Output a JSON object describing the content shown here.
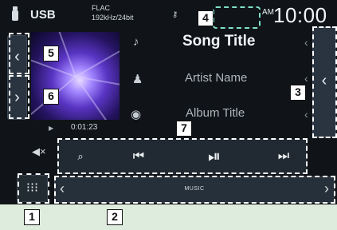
{
  "header": {
    "source": "USB",
    "format_line1": "FLAC",
    "format_line2": "192kHz/24bit",
    "ampm": "AM",
    "clock": "10:00"
  },
  "track": {
    "title": "Song Title",
    "artist": "Artist Name",
    "album": "Album Title",
    "elapsed": "0:01:23"
  },
  "funcbar": {
    "label": "MUSIC"
  },
  "callouts": [
    "1",
    "2",
    "3",
    "4",
    "5",
    "6",
    "7"
  ],
  "colors": {
    "screen_bg": "#101418",
    "page_bg": "#ddecdc",
    "tab_bg": "#2a3440",
    "accent_outline": "#7fe1c8"
  }
}
